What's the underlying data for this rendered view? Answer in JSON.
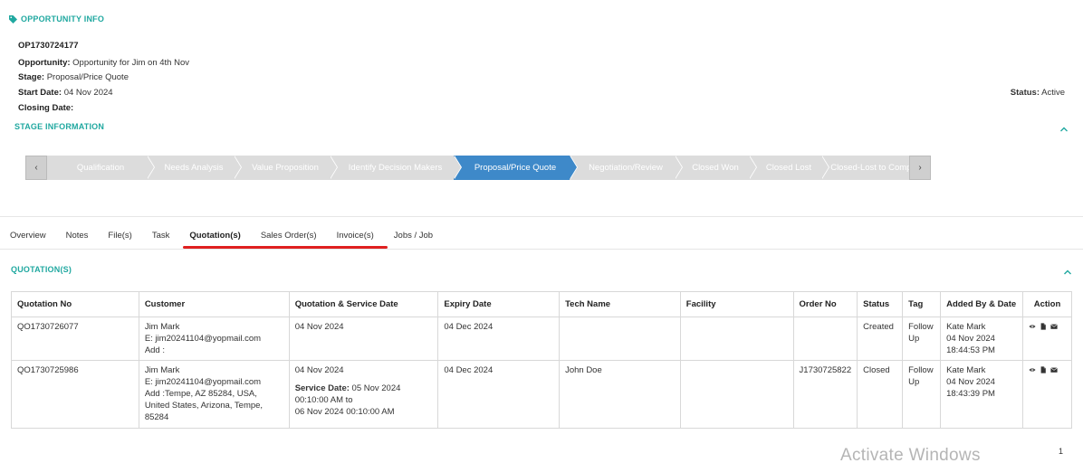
{
  "opportunity_info": {
    "header": "OPPORTUNITY INFO",
    "id": "OP1730724177",
    "opportunity_label": "Opportunity:",
    "opportunity_value": "Opportunity for Jim on 4th Nov",
    "stage_label": "Stage:",
    "stage_value": "Proposal/Price Quote",
    "start_date_label": "Start Date:",
    "start_date_value": "04 Nov 2024",
    "closing_date_label": "Closing Date:",
    "closing_date_value": "",
    "status_label": "Status:",
    "status_value": "Active"
  },
  "stage_information": {
    "header": "STAGE INFORMATION",
    "prev_glyph": "‹",
    "next_glyph": "›",
    "stages": [
      {
        "label": "Qualification",
        "active": false
      },
      {
        "label": "Needs Analysis",
        "active": false
      },
      {
        "label": "Value Proposition",
        "active": false
      },
      {
        "label": "Identify Decision Makers",
        "active": false
      },
      {
        "label": "Proposal/Price Quote",
        "active": true
      },
      {
        "label": "Negotiation/Review",
        "active": false
      },
      {
        "label": "Closed Won",
        "active": false
      },
      {
        "label": "Closed Lost",
        "active": false
      },
      {
        "label": "Closed-Lost to Competition",
        "active": false
      }
    ]
  },
  "tabs": [
    {
      "label": "Overview",
      "active": false
    },
    {
      "label": "Notes",
      "active": false
    },
    {
      "label": "File(s)",
      "active": false
    },
    {
      "label": "Task",
      "active": false
    },
    {
      "label": "Quotation(s)",
      "active": true
    },
    {
      "label": "Sales Order(s)",
      "active": false
    },
    {
      "label": "Invoice(s)",
      "active": false
    },
    {
      "label": "Jobs / Job",
      "active": false
    }
  ],
  "quotations": {
    "header": "QUOTATION(S)",
    "columns": [
      "Quotation No",
      "Customer",
      "Quotation & Service Date",
      "Expiry Date",
      "Tech Name",
      "Facility",
      "Order No",
      "Status",
      "Tag",
      "Added By & Date",
      "Action"
    ],
    "rows": [
      {
        "quotation_no": "QO1730726077",
        "customer_name": "Jim Mark",
        "customer_email": "E: jim20241104@yopmail.com",
        "customer_address": "Add :",
        "quotation_date": "04 Nov 2024",
        "service_date_label": "",
        "service_date_value": "",
        "service_time_from": "",
        "service_time_to": "",
        "expiry_date": "04 Dec 2024",
        "tech_name": "",
        "facility": "",
        "order_no": "",
        "status": "Created",
        "tag": "Follow Up",
        "added_by": "Kate Mark",
        "added_date": "04 Nov 2024",
        "added_time": "18:44:53 PM"
      },
      {
        "quotation_no": "QO1730725986",
        "customer_name": "Jim Mark",
        "customer_email": "E: jim20241104@yopmail.com",
        "customer_address": "Add :Tempe, AZ 85284, USA, United States, Arizona, Tempe, 85284",
        "quotation_date": "04 Nov 2024",
        "service_date_label": "Service Date:",
        "service_date_value": "05 Nov 2024",
        "service_time_from": "00:10:00 AM to",
        "service_time_to": "06 Nov 2024 00:10:00 AM",
        "expiry_date": "04 Dec 2024",
        "tech_name": "John Doe",
        "facility": "",
        "order_no": "J1730725822",
        "status": "Closed",
        "tag": "Follow Up",
        "added_by": "Kate Mark",
        "added_date": "04 Nov 2024",
        "added_time": "18:43:39 PM"
      }
    ],
    "action_icons": [
      "eye-icon",
      "document-icon",
      "envelope-icon"
    ]
  },
  "footer": {
    "watermark": "Activate Windows",
    "page_number": "1"
  },
  "colors": {
    "accent": "#20a8a0",
    "active_stage": "#3e89c9",
    "stage_bg": "#dcdcdc",
    "tab_underline": "#e02020"
  }
}
